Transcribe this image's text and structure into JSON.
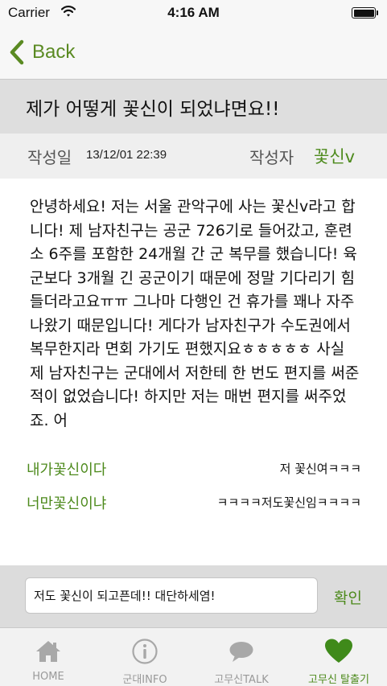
{
  "status_bar": {
    "carrier": "Carrier",
    "time": "4:16 AM",
    "battery_level": 1.0
  },
  "nav": {
    "back_label": "Back",
    "accent_color": "#5a8a22"
  },
  "post": {
    "title": "제가 어떻게 꽃신이 되었냐면요!!",
    "date_label": "작성일",
    "date": "13/12/01 22:39",
    "author_label": "작성자",
    "author": "꽃신v",
    "body": "안녕하세요! 저는 서울 관악구에 사는 꽃신v라고 합니다! 제 남자친구는 공군 726기로 들어갔고, 훈련소 6주를 포함한 24개월 간 군 복무를 했습니다! 육군보다 3개월 긴 공군이기 때문에 정말 기다리기 힘들더라고요ㅠㅠ 그나마 다행인 건 휴가를 꽤나 자주 나왔기 때문입니다! 게다가 남자친구가 수도권에서 복무한지라 면회 가기도 편했지요ㅎㅎㅎㅎㅎ 사실 제 남자친구는 군대에서 저한테 한 번도 편지를 써준 적이 없었습니다! 하지만 저는 매번 편지를 써주었죠. 어"
  },
  "comments": [
    {
      "user": "내가꽃신이다",
      "text": "저 꽃신여ㅋㅋㅋ"
    },
    {
      "user": "너만꽃신이냐",
      "text": "ㅋㅋㅋㅋ저도꽃신임ㅋㅋㅋㅋ"
    }
  ],
  "comment_input": {
    "value": "저도 꽃신이 되고픈데!! 대단하세염!",
    "placeholder": ""
  },
  "confirm_label": "확인",
  "tabs": [
    {
      "label": "HOME",
      "icon": "home-icon",
      "active": false
    },
    {
      "label": "군대INFO",
      "icon": "info-icon",
      "active": false
    },
    {
      "label": "고무신TALK",
      "icon": "speech-bubble-icon",
      "active": false
    },
    {
      "label": "고무신 탈출기",
      "icon": "heart-icon",
      "active": true
    }
  ],
  "colors": {
    "accent": "#4d8a1c",
    "inactive_tab": "#999999",
    "title_bar_bg": "#dedede"
  }
}
